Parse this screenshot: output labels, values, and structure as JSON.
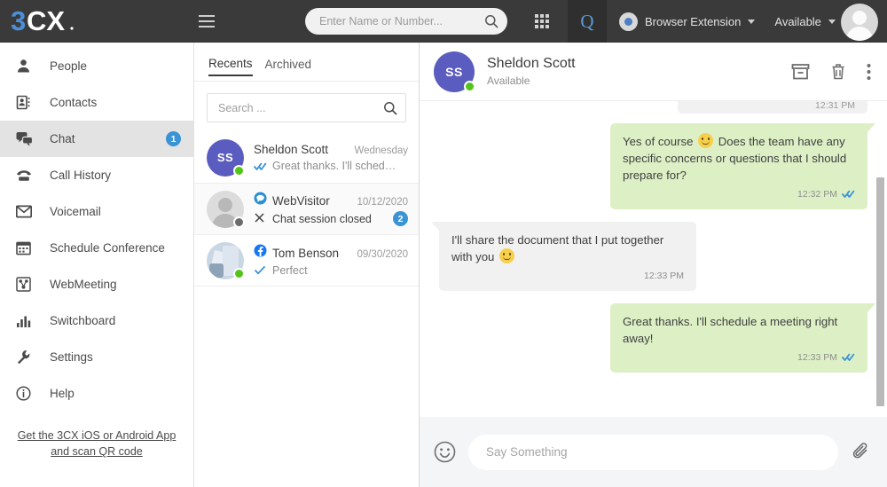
{
  "topbar": {
    "logo_text": "3CX",
    "menu_icon": "hamburger-icon",
    "search": {
      "placeholder": "Enter Name or Number...",
      "value": ""
    },
    "dialpad_icon": "dialpad-icon",
    "queue_label": "Q",
    "browser_extension": {
      "label": "Browser Extension",
      "icon": "chrome-icon"
    },
    "presence": {
      "label": "Available"
    },
    "avatar": "user-avatar"
  },
  "sidebar": {
    "items": [
      {
        "label": "People",
        "icon": "person-icon",
        "badge": "",
        "active": false
      },
      {
        "label": "Contacts",
        "icon": "contacts-book-icon",
        "badge": "",
        "active": false
      },
      {
        "label": "Chat",
        "icon": "chat-bubbles-icon",
        "badge": "1",
        "active": true
      },
      {
        "label": "Call History",
        "icon": "phone-icon",
        "badge": "",
        "active": false
      },
      {
        "label": "Voicemail",
        "icon": "envelope-icon",
        "badge": "",
        "active": false
      },
      {
        "label": "Schedule Conference",
        "icon": "calendar-icon",
        "badge": "",
        "active": false
      },
      {
        "label": "WebMeeting",
        "icon": "webmeeting-icon",
        "badge": "",
        "active": false
      },
      {
        "label": "Switchboard",
        "icon": "bar-chart-icon",
        "badge": "",
        "active": false
      },
      {
        "label": "Settings",
        "icon": "wrench-icon",
        "badge": "",
        "active": false
      },
      {
        "label": "Help",
        "icon": "info-circle-icon",
        "badge": "",
        "active": false
      }
    ],
    "app_link_line1": "Get the 3CX iOS or Android App",
    "app_link_line2": "and scan QR code"
  },
  "chatlist": {
    "tabs": [
      {
        "label": "Recents",
        "active": true
      },
      {
        "label": "Archived",
        "active": false
      }
    ],
    "search": {
      "placeholder": "Search ...",
      "value": ""
    },
    "conversations": [
      {
        "name": "Sheldon Scott",
        "initials": "SS",
        "avatar_color": "#5b5cbf",
        "avatar_type": "initials",
        "presence": "green",
        "time": "Wednesday",
        "preview": "Great thanks. I'll sched…",
        "status_icon": "double-check-icon",
        "source_icon": "",
        "badge": "",
        "selected": true
      },
      {
        "name": "WebVisitor",
        "initials": "",
        "avatar_color": "#dcdcdc",
        "avatar_type": "person",
        "presence": "grey",
        "time": "10/12/2020",
        "preview": "Chat session closed",
        "status_icon": "close-x-icon",
        "source_icon": "livechat-icon",
        "badge": "2",
        "selected": false
      },
      {
        "name": "Tom Benson",
        "initials": "",
        "avatar_color": "#c9d6e4",
        "avatar_type": "photo",
        "presence": "green",
        "time": "09/30/2020",
        "preview": "Perfect",
        "status_icon": "single-check-icon",
        "source_icon": "facebook-icon",
        "badge": "",
        "selected": false
      }
    ]
  },
  "conversation": {
    "header": {
      "name": "Sheldon Scott",
      "initials": "SS",
      "avatar_color": "#5b5cbf",
      "status": "Available",
      "presence": "green",
      "actions": [
        {
          "name": "archive-button",
          "icon": "archive-icon"
        },
        {
          "name": "delete-button",
          "icon": "trash-icon"
        },
        {
          "name": "more-button",
          "icon": "kebab-menu-icon"
        }
      ]
    },
    "clipped_message_time": "12:31 PM",
    "messages": [
      {
        "direction": "out",
        "text_before_emoji": "Yes of course",
        "emoji": "slight-smile-emoji",
        "text_after_emoji": "Does the team have any specific concerns or questions that I should prepare for?",
        "time": "12:32 PM",
        "status_icon": "double-check-icon"
      },
      {
        "direction": "in",
        "text_before_emoji": "I'll share the document that I put together with you",
        "emoji": "slight-smile-emoji",
        "text_after_emoji": "",
        "time": "12:33 PM",
        "status_icon": ""
      },
      {
        "direction": "out",
        "text_before_emoji": "Great thanks. I'll schedule a meeting right away!",
        "emoji": "",
        "text_after_emoji": "",
        "time": "12:33 PM",
        "status_icon": "double-check-icon"
      }
    ],
    "composer": {
      "emoji_icon": "smiley-icon",
      "placeholder": "Say Something",
      "value": "",
      "attach_icon": "paperclip-icon"
    }
  },
  "colors": {
    "topbar_bg": "#3a3a3a",
    "accent_blue": "#3a93d4",
    "outgoing_bubble": "#ddf0c5",
    "incoming_bubble": "#f1f1f1",
    "presence_green": "#53c41a",
    "avatar_purple": "#5b5cbf",
    "logo_blue": "#4a90d9"
  }
}
